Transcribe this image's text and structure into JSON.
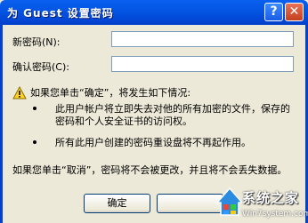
{
  "window": {
    "title": "为 Guest 设置密码",
    "help_label": "?",
    "close_label": "✕"
  },
  "form": {
    "new_password_label": "新密码(N):",
    "confirm_password_label": "确认密码(C):",
    "new_password_value": "",
    "confirm_password_value": ""
  },
  "message": {
    "intro": "如果您单击“确定”，将发生如下情况:",
    "bullet1_line1": "此用户帐户将立即失去对他的所有加密的文件，保存的",
    "bullet1_line2": "密码和个人安全证书的访问权。",
    "bullet2": "所有此用户创建的密码重设盘将不再起作用。",
    "cancel_note": "如果您单击“取消”，密码将不会被更改，并且将不会丢失数据。"
  },
  "buttons": {
    "ok_label": "确定"
  },
  "watermark": {
    "text": "系统之家",
    "url": "Win7system.com"
  }
}
